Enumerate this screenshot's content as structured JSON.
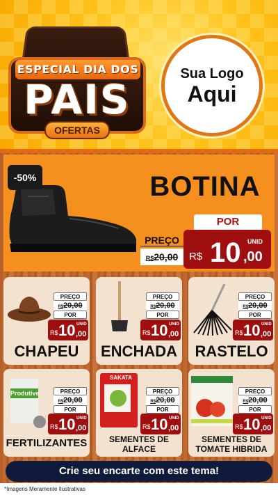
{
  "header": {
    "badge_top": "ESPECIAL DIA DOS",
    "badge_main": "PAIS",
    "badge_bottom": "OFERTAS",
    "logo_line1": "Sua Logo",
    "logo_line2": "Aqui"
  },
  "hero": {
    "discount": "-50%",
    "title": "BOTINA",
    "preco_label": "PREÇO",
    "old_currency": "R$",
    "old_price": "20,00",
    "por_label": "POR",
    "unid": "UNID",
    "currency": "R$",
    "price_int": "10",
    "price_cents": ",00"
  },
  "products": [
    {
      "name": "CHAPEU",
      "preco_label": "PREÇO",
      "old_currency": "R$",
      "old_price": "20,00",
      "por_label": "POR",
      "currency": "R$",
      "price_int": "10",
      "price_cents": ",00",
      "unid": "UNID",
      "icon": "hat-icon"
    },
    {
      "name": "ENCHADA",
      "preco_label": "PREÇO",
      "old_currency": "R$",
      "old_price": "20,00",
      "por_label": "POR",
      "currency": "R$",
      "price_int": "10",
      "price_cents": ",00",
      "unid": "UNID",
      "icon": "hoe-icon"
    },
    {
      "name": "RASTELO",
      "preco_label": "PREÇO",
      "old_currency": "R$",
      "old_price": "20,00",
      "por_label": "POR",
      "currency": "R$",
      "price_int": "10",
      "price_cents": ",00",
      "unid": "UNID",
      "icon": "rake-icon"
    },
    {
      "name": "FERTILIZANTES",
      "package_label": "Produtive",
      "preco_label": "PREÇO",
      "old_currency": "R$",
      "old_price": "20,00",
      "por_label": "POR",
      "currency": "R$",
      "price_int": "10",
      "price_cents": ",00",
      "unid": "UNID",
      "icon": "fertilizer-bag-icon"
    },
    {
      "name_line1": "SEMENTES DE",
      "name_line2": "ALFACE",
      "package_label": "SAKATA",
      "preco_label": "PREÇO",
      "old_currency": "R$",
      "old_price": "20,00",
      "por_label": "POR",
      "currency": "R$",
      "price_int": "10",
      "price_cents": ",00",
      "unid": "UNID",
      "icon": "seed-packet-icon"
    },
    {
      "name_line1": "SEMENTES DE",
      "name_line2": "TOMATE HIBRIDA",
      "preco_label": "PREÇO",
      "old_currency": "R$",
      "old_price": "20,00",
      "por_label": "POR",
      "currency": "R$",
      "price_int": "10",
      "price_cents": ",00",
      "unid": "UNID",
      "icon": "tomato-seed-packet-icon"
    }
  ],
  "cta": "Crie seu encarte com este tema!",
  "footer_note": "*Imagens Meramente Ilustrativas",
  "colors": {
    "accent_red": "#a00f0f",
    "brand_orange": "#f5901e",
    "navy": "#101a3a"
  }
}
